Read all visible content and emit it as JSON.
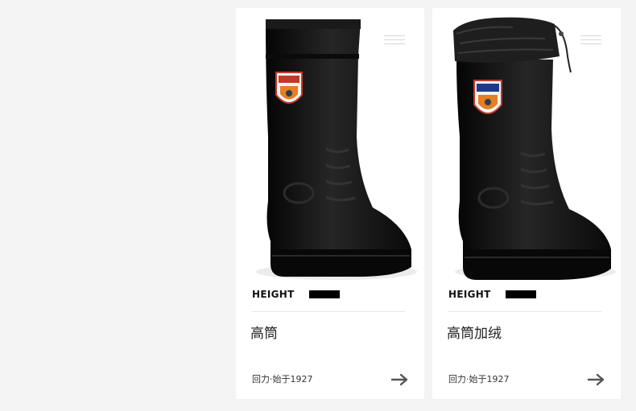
{
  "products": [
    {
      "height_label": "HEIGHT",
      "name": "高筒",
      "brand": "回力·始于1927",
      "image_desc_icon": "rain-boot-image",
      "arrow_icon": "arrow-right-icon"
    },
    {
      "height_label": "HEIGHT",
      "name": "高筒加绒",
      "brand": "回力·始于1927",
      "image_desc_icon": "fleece-lined-rain-boot-image",
      "arrow_icon": "arrow-right-icon"
    }
  ],
  "colors": {
    "page_bg": "#f4f4f4",
    "card_bg": "#ffffff",
    "boot": "#141414",
    "badge_red": "#c0392b",
    "badge_orange": "#e67e22"
  }
}
